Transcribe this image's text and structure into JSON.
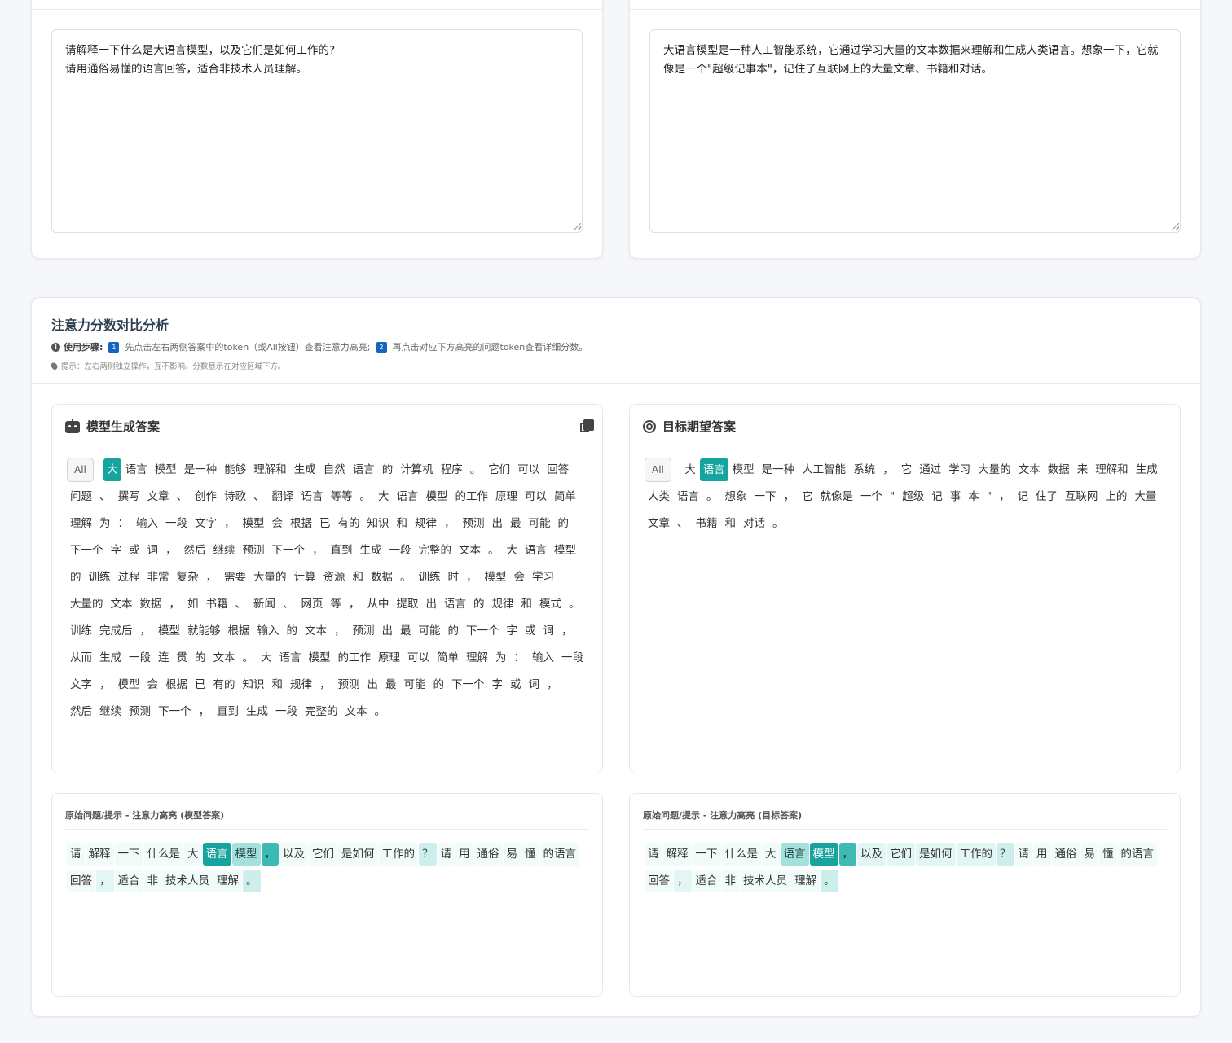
{
  "question_box": {
    "text": "请解释一下什么是大语言模型，以及它们是如何工作的?\n请用通俗易懂的语言回答，适合非技术人员理解。"
  },
  "target_box": {
    "text": "大语言模型是一种人工智能系统，它通过学习大量的文本数据来理解和生成人类语言。想象一下，它就像是一个\"超级记事本\"，记住了互联网上的大量文章、书籍和对话。"
  },
  "analysis": {
    "title": "注意力分数对比分析",
    "steps_label": "使用步骤:",
    "step1_num": "1",
    "step1_text": "先点击左右两侧答案中的token（或All按钮）查看注意力高亮;",
    "step2_num": "2",
    "step2_text": "再点击对应下方高亮的问题token查看详细分数。",
    "tip": "提示：左右两侧独立操作，互不影响。分数显示在对应区域下方。"
  },
  "model_panel": {
    "title": "模型生成答案",
    "all_label": "All",
    "tokens": [
      "大",
      "语言",
      "模型",
      "是一种",
      "能够",
      "理解和",
      "生成",
      "自然",
      "语言",
      "的",
      "计算机",
      "程序",
      "。",
      "它们",
      "可以",
      "回答",
      "问题",
      "、",
      "撰写",
      "文章",
      "、",
      "创作",
      "诗歌",
      "、",
      "翻译",
      "语言",
      "等等",
      "。",
      "大",
      "语言",
      "模型",
      "的工作",
      "原理",
      "可以",
      "简单",
      "理解",
      "为",
      "：",
      "输入",
      "一段",
      "文字",
      "，",
      "模型",
      "会",
      "根据",
      "已",
      "有的",
      "知识",
      "和",
      "规律",
      "，",
      "预测",
      "出",
      "最",
      "可能",
      "的",
      "下一个",
      "字",
      "或",
      "词",
      "，",
      "然后",
      "继续",
      "预测",
      "下一个",
      "，",
      "直到",
      "生成",
      "一段",
      "完整的",
      "文本",
      "。",
      "大",
      "语言",
      "模型",
      "的",
      "训练",
      "过程",
      "非常",
      "复杂",
      "，",
      "需要",
      "大量的",
      "计算",
      "资源",
      "和",
      "数据",
      "。",
      "训练",
      "时",
      "，",
      "模型",
      "会",
      "学习",
      "大量的",
      "文本",
      "数据",
      "，",
      "如",
      "书籍",
      "、",
      "新闻",
      "、",
      "网页",
      "等",
      "，",
      "从中",
      "提取",
      "出",
      "语言",
      "的",
      "规律",
      "和",
      "模式",
      "。",
      "训练",
      "完成后",
      "，",
      "模型",
      "就能够",
      "根据",
      "输入",
      "的",
      "文本",
      "，",
      "预测",
      "出",
      "最",
      "可能",
      "的",
      "下一个",
      "字",
      "或",
      "词",
      "，",
      "从而",
      "生成",
      "一段",
      "连",
      "贯",
      "的",
      "文本",
      "。",
      "大",
      "语言",
      "模型",
      "的工作",
      "原理",
      "可以",
      "简单",
      "理解",
      "为",
      "：",
      "输入",
      "一段",
      "文字",
      "，",
      "模型",
      "会",
      "根据",
      "已",
      "有的",
      "知识",
      "和",
      "规律",
      "，",
      "预测",
      "出",
      "最",
      "可能",
      "的",
      "下一个",
      "字",
      "或",
      "词",
      "，",
      "然后",
      "继续",
      "预测",
      "下一个",
      "，",
      "直到",
      "生成",
      "一段",
      "完整的",
      "文本",
      "。"
    ],
    "selected_index": 0
  },
  "target_panel": {
    "title": "目标期望答案",
    "all_label": "All",
    "tokens": [
      "大",
      "语言",
      "模型",
      "是一种",
      "人工智能",
      "系统",
      "，",
      "它",
      "通过",
      "学习",
      "大量的",
      "文本",
      "数据",
      "来",
      "理解和",
      "生成",
      "人类",
      "语言",
      "。",
      "想象",
      "一下",
      "，",
      "它",
      "就像是",
      "一个",
      "\"",
      "超级",
      "记",
      "事",
      "本",
      "\"",
      "，",
      "记",
      "住了",
      "互联网",
      "上的",
      "大量",
      "文章",
      "、",
      "书籍",
      "和",
      "对话",
      "。"
    ],
    "selected_index": 1
  },
  "prompt_model": {
    "title": "原始问题/提示 - 注意力高亮 (模型答案)",
    "tokens": [
      "请",
      "解释",
      "一下",
      "什么是",
      "大",
      "语言",
      "模型",
      "，",
      "以及",
      "它们",
      "是如何",
      "工作的",
      "？",
      "请",
      "用",
      "通俗",
      "易",
      "懂",
      "的语言",
      "回答",
      "，",
      "适合",
      "非",
      "技术人员",
      "理解",
      "。"
    ],
    "levels": [
      6,
      6,
      6,
      6,
      6,
      1,
      3,
      2,
      6,
      6,
      6,
      6,
      4,
      6,
      6,
      6,
      6,
      6,
      6,
      6,
      5,
      6,
      6,
      6,
      6,
      4
    ]
  },
  "prompt_target": {
    "title": "原始问题/提示 - 注意力高亮 (目标答案)",
    "tokens": [
      "请",
      "解释",
      "一下",
      "什么是",
      "大",
      "语言",
      "模型",
      "，",
      "以及",
      "它们",
      "是如何",
      "工作的",
      "？",
      "请",
      "用",
      "通俗",
      "易",
      "懂",
      "的语言",
      "回答",
      "，",
      "适合",
      "非",
      "技术人员",
      "理解",
      "。"
    ],
    "levels": [
      6,
      6,
      6,
      6,
      6,
      3,
      1,
      2,
      5,
      5,
      5,
      5,
      4,
      6,
      6,
      6,
      6,
      6,
      6,
      6,
      5,
      6,
      6,
      6,
      6,
      4
    ]
  }
}
